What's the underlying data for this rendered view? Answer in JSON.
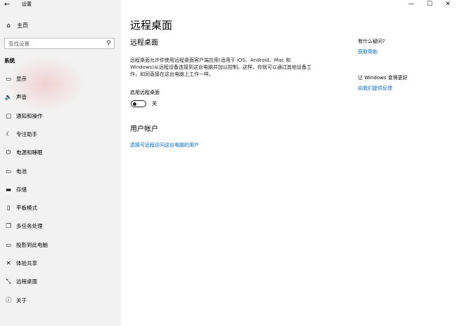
{
  "window": {
    "title": "设置",
    "back_icon": "←",
    "controls": {
      "minimize": "—",
      "maximize": "☐",
      "close": "✕"
    }
  },
  "sidebar": {
    "home": {
      "icon": "⌂",
      "label": "主页"
    },
    "search": {
      "placeholder": "查找设置",
      "icon": "⚲"
    },
    "section_label": "系统",
    "items": [
      {
        "icon": "▭",
        "label": "显示"
      },
      {
        "icon": "🔈",
        "label": "声音"
      },
      {
        "icon": "▢",
        "label": "通知和操作"
      },
      {
        "icon": "☾",
        "label": "专注助手"
      },
      {
        "icon": "⏻",
        "label": "电源和睡眠"
      },
      {
        "icon": "▭",
        "label": "电池"
      },
      {
        "icon": "▬",
        "label": "存储"
      },
      {
        "icon": "▯",
        "label": "平板模式"
      },
      {
        "icon": "❐",
        "label": "多任务处理"
      },
      {
        "icon": "▭",
        "label": "投影到此电脑"
      },
      {
        "icon": "✕",
        "label": "体验共享"
      },
      {
        "icon": "⤡",
        "label": "远程桌面"
      },
      {
        "icon": "ⓘ",
        "label": "关于"
      }
    ]
  },
  "main": {
    "page_title": "远程桌面",
    "section_title": "远程桌面",
    "description": "远程桌面允许你使用远程桌面客户端应用(适用于 iOS、Android、Mac 和 Windows)从远程设备连接到这台电脑并加以控制。这样，你就可以通过其他设备工作，如同直接在这台电脑上工作一样。",
    "enable_label": "启用远程桌面",
    "toggle_state_label": "关",
    "toggle_on": false,
    "accounts_title": "用户帐户",
    "accounts_link": "选择可远程访问这台电脑的用户"
  },
  "right_panel": {
    "question": "有什么疑问?",
    "help_link": "获取帮助",
    "improve": "让 Windows 变得更好",
    "feedback_link": "向我们提供反馈"
  },
  "colors": {
    "link": "#0067b8",
    "sidebar_bg": "#f2f2f2"
  }
}
